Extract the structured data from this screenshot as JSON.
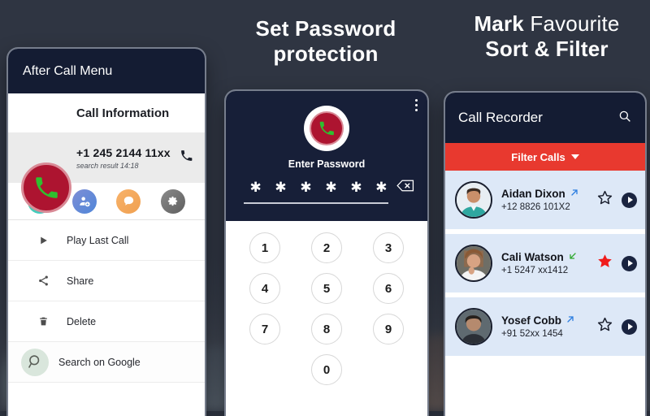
{
  "headings": {
    "middle": {
      "line1": "Set Password",
      "line2": "protection"
    },
    "right": {
      "line1_bold": "Mark",
      "line1_thin": " Favourite",
      "line2": "Sort & Filter"
    }
  },
  "left_phone": {
    "title": "After Call Menu",
    "call_information_label": "Call Information",
    "phone_number": "+1 245 2144 11xx",
    "sub_text": "search result 14:18",
    "quick_actions": [
      {
        "name": "call-action",
        "icon": "phone-icon"
      },
      {
        "name": "add-contact-action",
        "icon": "add-contact-icon"
      },
      {
        "name": "message-action",
        "icon": "message-icon"
      },
      {
        "name": "settings-action",
        "icon": "gear-icon"
      }
    ],
    "menu_items": [
      {
        "label": "Play Last Call",
        "icon": "play-icon"
      },
      {
        "label": "Share",
        "icon": "share-icon"
      },
      {
        "label": "Delete",
        "icon": "trash-icon"
      },
      {
        "label": "Search on Google",
        "icon": "search-icon"
      }
    ]
  },
  "middle_phone": {
    "enter_password_label": "Enter Password",
    "password_masked": "✱ ✱ ✱ ✱ ✱ ✱",
    "password_length": 6,
    "keypad": [
      [
        "1",
        "2",
        "3"
      ],
      [
        "4",
        "5",
        "6"
      ],
      [
        "7",
        "8",
        "9"
      ],
      [
        "0"
      ]
    ],
    "overflow_menu_icon": "kebab-menu-icon",
    "backspace_icon": "backspace-icon"
  },
  "right_phone": {
    "title": "Call Recorder",
    "search_icon": "search-icon",
    "filter_label": "Filter Calls",
    "calls": [
      {
        "name": "Aidan Dixon",
        "number": "+12 8826 101X2",
        "direction": "outgoing",
        "favourite": false,
        "avatar_tone": "#c98f6a"
      },
      {
        "name": "Cali Watson",
        "number": "+1 5247 xx1412",
        "direction": "incoming",
        "favourite": true,
        "avatar_tone": "#d8a383"
      },
      {
        "name": "Yosef Cobb",
        "number": "+91 52xx 1454",
        "direction": "outgoing",
        "favourite": false,
        "avatar_tone": "#b58a6e"
      }
    ]
  },
  "colors": {
    "background": "#2f3542",
    "header_navy": "#141c33",
    "filter_red": "#e8392f",
    "list_blue": "#dde8f7",
    "logo_red": "#ad1430",
    "logo_green": "#2fbf2f",
    "favourite_red": "#f01b1b",
    "outgoing_blue": "#2b7de0",
    "incoming_green": "#2fa82f"
  }
}
